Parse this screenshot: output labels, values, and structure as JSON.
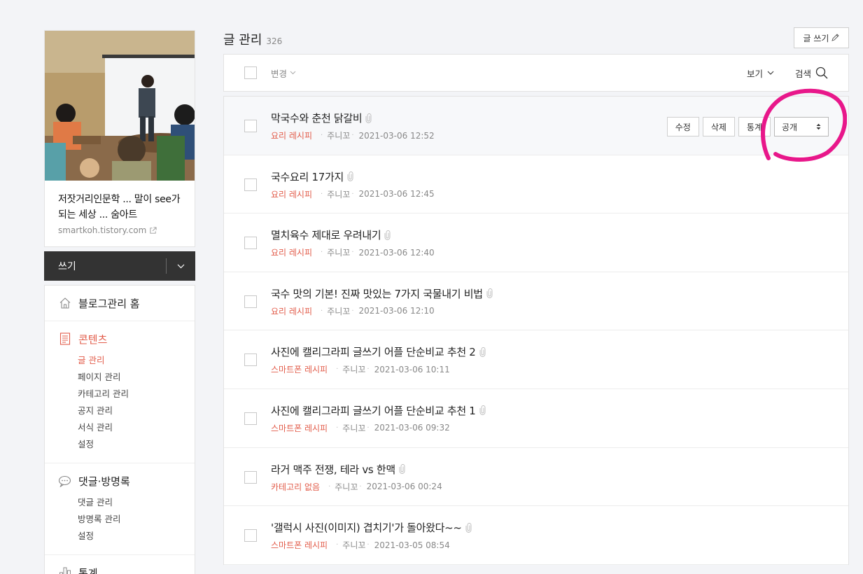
{
  "sidebar": {
    "blog_title": "저잣거리인문학 ... 말이 see가 되는 세상 ... 숨아트",
    "blog_url": "smartkoh.tistory.com",
    "write_label": "쓰기",
    "home_label": "블로그관리 홈",
    "contents": {
      "label": "콘텐츠",
      "items": [
        "글 관리",
        "페이지 관리",
        "카테고리 관리",
        "공지 관리",
        "서식 관리",
        "설정"
      ]
    },
    "comments": {
      "label": "댓글·방명록",
      "items": [
        "댓글 관리",
        "방명록 관리",
        "설정"
      ]
    },
    "stats_label": "통계"
  },
  "header": {
    "title": "글 관리",
    "count": "326",
    "write_button": "글 쓰기"
  },
  "toolbar": {
    "change_label": "변경",
    "view_label": "보기",
    "search_label": "검색"
  },
  "row_actions": {
    "edit": "수정",
    "delete": "삭제",
    "stats": "통계",
    "visibility": "공개"
  },
  "posts": [
    {
      "title": "막국수와 춘천 닭갈비",
      "category": "요리 레시피",
      "author": "주니꼬",
      "date": "2021-03-06 12:52"
    },
    {
      "title": "국수요리 17가지",
      "category": "요리 레시피",
      "author": "주니꼬",
      "date": "2021-03-06 12:45"
    },
    {
      "title": "멸치육수 제대로 우려내기",
      "category": "요리 레시피",
      "author": "주니꼬",
      "date": "2021-03-06 12:40"
    },
    {
      "title": "국수 맛의 기본! 진짜 맛있는 7가지 국물내기 비법",
      "category": "요리 레시피",
      "author": "주니꼬",
      "date": "2021-03-06 12:10"
    },
    {
      "title": "사진에 캘리그라피 글쓰기 어플 단순비교 추천 2",
      "category": "스마트폰 레시피",
      "author": "주니꼬",
      "date": "2021-03-06 10:11"
    },
    {
      "title": "사진에 캘리그라피 글쓰기 어플 단순비교 추천 1",
      "category": "스마트폰 레시피",
      "author": "주니꼬",
      "date": "2021-03-06 09:32"
    },
    {
      "title": "라거 맥주 전쟁, 테라 vs 한맥",
      "category": "카테고리 없음",
      "author": "주니꼬",
      "date": "2021-03-06 00:24"
    },
    {
      "title": "'갤럭시 사진(이미지) 겹치기'가 돌아왔다~~",
      "category": "스마트폰 레시피",
      "author": "주니꼬",
      "date": "2021-03-05 08:54"
    }
  ],
  "colors": {
    "accent": "#e25c4a",
    "annotation": "#e8178a",
    "dark_bar": "#333333"
  }
}
